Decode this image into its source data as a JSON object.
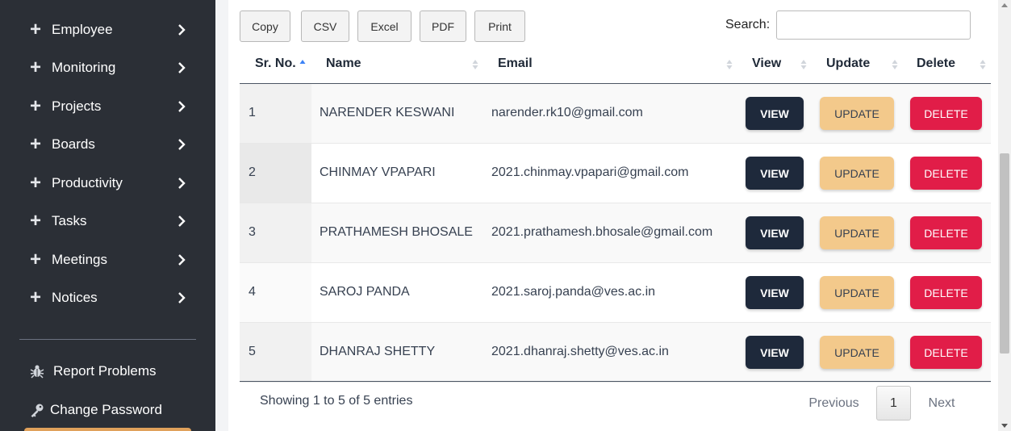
{
  "sidebar": {
    "items": [
      {
        "label": "Employee"
      },
      {
        "label": "Monitoring"
      },
      {
        "label": "Projects"
      },
      {
        "label": "Boards"
      },
      {
        "label": "Productivity"
      },
      {
        "label": "Tasks"
      },
      {
        "label": "Meetings"
      },
      {
        "label": "Notices"
      }
    ],
    "report_problems": "Report Problems",
    "change_password": "Change Password",
    "accent_color": "#e0a15b"
  },
  "toolbar": {
    "copy": "Copy",
    "csv": "CSV",
    "excel": "Excel",
    "pdf": "PDF",
    "print": "Print",
    "search_label": "Search:",
    "search_value": ""
  },
  "table": {
    "headers": {
      "sr_no": "Sr. No.",
      "name": "Name",
      "email": "Email",
      "view": "View",
      "update": "Update",
      "delete": "Delete"
    },
    "rows": [
      {
        "sr": "1",
        "name": "NARENDER KESWANI",
        "email": "narender.rk10@gmail.com"
      },
      {
        "sr": "2",
        "name": "CHINMAY VPAPARI",
        "email": "2021.chinmay.vpapari@gmail.com"
      },
      {
        "sr": "3",
        "name": "PRATHAMESH BHOSALE",
        "email": "2021.prathamesh.bhosale@gmail.com"
      },
      {
        "sr": "4",
        "name": "SAROJ PANDA",
        "email": "2021.saroj.panda@ves.ac.in"
      },
      {
        "sr": "5",
        "name": "DHANRAJ SHETTY",
        "email": "2021.dhanraj.shetty@ves.ac.in"
      }
    ],
    "actions": {
      "view": "VIEW",
      "update": "UPDATE",
      "delete": "DELETE"
    }
  },
  "footer": {
    "showing": "Showing 1 to 5 of 5 entries",
    "previous": "Previous",
    "current_page": "1",
    "next": "Next"
  },
  "colors": {
    "sidebar_bg": "#2b2f36",
    "view_button": "#1e293b",
    "update_button": "#f3c98b",
    "delete_button": "#e11d48"
  }
}
